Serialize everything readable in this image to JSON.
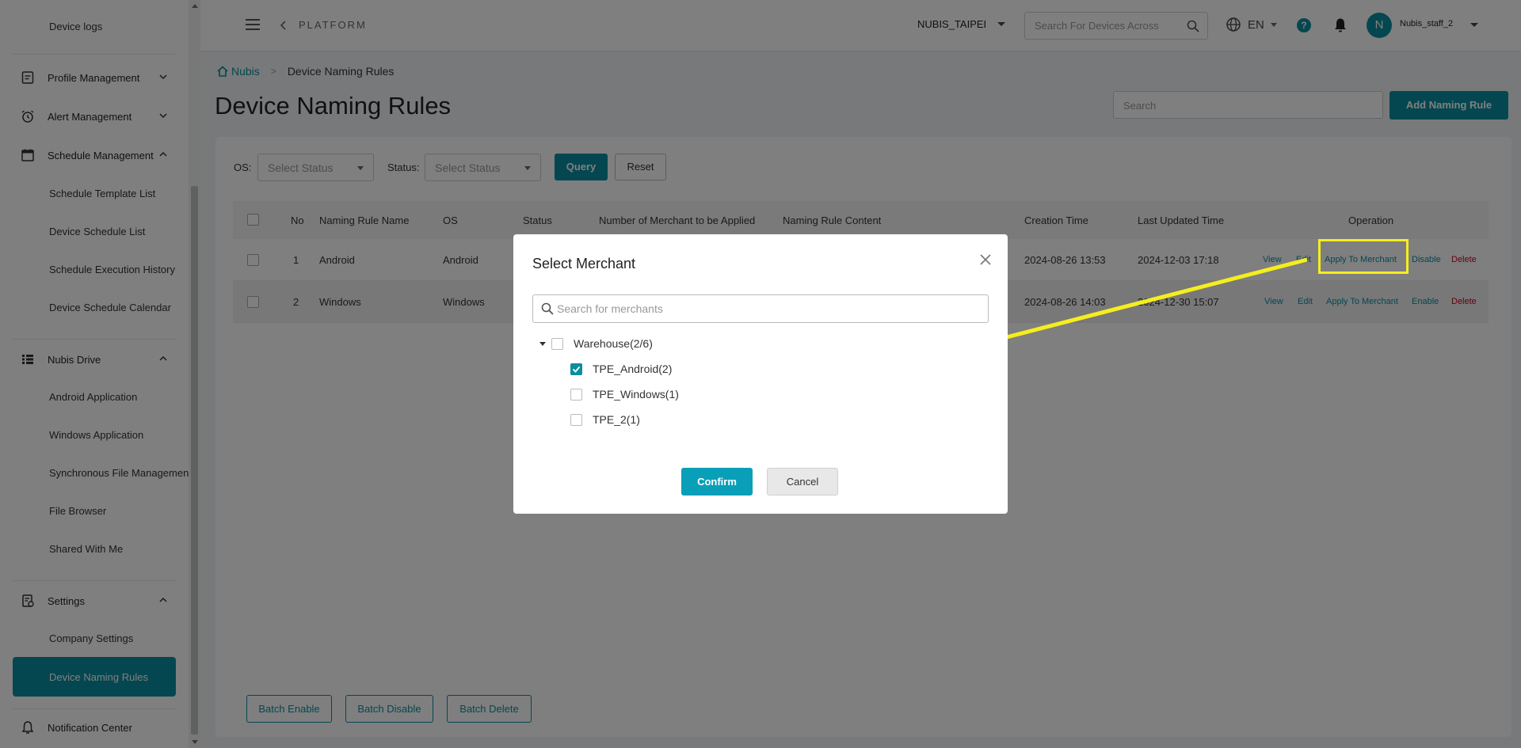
{
  "sidebar": {
    "items": {
      "device_logs": "Device logs",
      "profile_management": "Profile Management",
      "alert_management": "Alert Management",
      "schedule_management": "Schedule Management",
      "schedule_template_list": "Schedule Template List",
      "device_schedule_list": "Device Schedule List",
      "schedule_execution_history": "Schedule Execution History",
      "device_schedule_calendar": "Device Schedule Calendar",
      "nubis_drive": "Nubis Drive",
      "android_application": "Android Application",
      "windows_application": "Windows Application",
      "synchronous_file_management": "Synchronous File Management",
      "file_browser": "File Browser",
      "shared_with_me": "Shared With Me",
      "settings": "Settings",
      "company_settings": "Company Settings",
      "device_naming_rules": "Device Naming Rules",
      "notification_center": "Notification Center"
    }
  },
  "header": {
    "platform": "PLATFORM",
    "tenant": "NUBIS_TAIPEI",
    "search_placeholder": "Search For Devices Across",
    "language": "EN",
    "help": "?",
    "avatar_initial": "N",
    "username": "Nubis_staff_2"
  },
  "breadcrumb": {
    "home": "Nubis",
    "current": "Device Naming Rules"
  },
  "page": {
    "title": "Device Naming Rules",
    "search_placeholder": "Search",
    "add_button": "Add Naming Rule"
  },
  "filters": {
    "os_label": "OS:",
    "os_placeholder": "Select Status",
    "status_label": "Status:",
    "status_placeholder": "Select Status",
    "query": "Query",
    "reset": "Reset"
  },
  "table": {
    "columns": {
      "no": "No",
      "name": "Naming Rule Name",
      "os": "OS",
      "status": "Status",
      "merchants": "Number of Merchant to be Applied",
      "content": "Naming Rule Content",
      "created": "Creation Time",
      "updated": "Last Updated Time",
      "operation": "Operation"
    },
    "rows": [
      {
        "no": "1",
        "name": "Android",
        "os": "Android",
        "created": "2024-08-26 13:53",
        "updated": "2024-12-03 17:18",
        "ops": {
          "view": "View",
          "edit": "Edit",
          "apply": "Apply To Merchant",
          "toggle": "Disable",
          "delete": "Delete"
        }
      },
      {
        "no": "2",
        "name": "Windows",
        "os": "Windows",
        "created": "2024-08-26 14:03",
        "updated": "2024-12-30 15:07",
        "ops": {
          "view": "View",
          "edit": "Edit",
          "apply": "Apply To Merchant",
          "toggle": "Enable",
          "delete": "Delete"
        }
      }
    ]
  },
  "batch": {
    "enable": "Batch Enable",
    "disable": "Batch Disable",
    "delete": "Batch Delete"
  },
  "modal": {
    "title": "Select Merchant",
    "search_placeholder": "Search for merchants",
    "tree": {
      "parent": {
        "label": "Warehouse(2/6)",
        "checked": false
      },
      "children": [
        {
          "label": "TPE_Android(2)",
          "checked": true
        },
        {
          "label": "TPE_Windows(1)",
          "checked": false
        },
        {
          "label": "TPE_2(1)",
          "checked": false
        }
      ]
    },
    "confirm": "Confirm",
    "cancel": "Cancel"
  },
  "colors": {
    "accent": "#0a8ea0",
    "danger": "#d0021b",
    "annotation": "#f5ee1e"
  }
}
